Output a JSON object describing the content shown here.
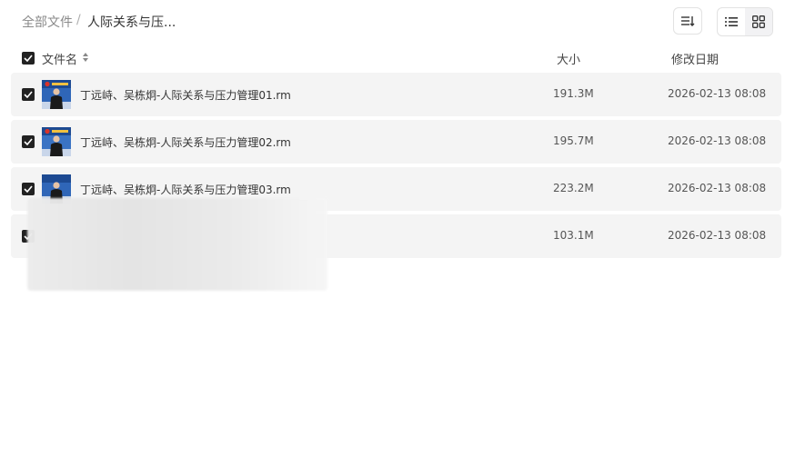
{
  "breadcrumb": {
    "root": "全部文件",
    "separator": "/",
    "current": "人际关系与压..."
  },
  "toolbar": {
    "sort_icon": "sort-icon",
    "list_view_icon": "list-view-icon",
    "grid_view_icon": "grid-view-icon",
    "active_view": "list"
  },
  "table": {
    "headers": {
      "name": "文件名",
      "size": "大小",
      "date": "修改日期"
    },
    "select_all_checked": true,
    "rows": [
      {
        "name": "丁远峙、吴栋炯-人际关系与压力管理01.rm",
        "size": "191.3M",
        "date": "2026-02-13 08:08",
        "checked": true
      },
      {
        "name": "丁远峙、吴栋炯-人际关系与压力管理02.rm",
        "size": "195.7M",
        "date": "2026-02-13 08:08",
        "checked": true
      },
      {
        "name": "丁远峙、吴栋炯-人际关系与压力管理03.rm",
        "size": "223.2M",
        "date": "2026-02-13 08:08",
        "checked": true
      },
      {
        "name": "",
        "size": "103.1M",
        "date": "2026-02-13 08:08",
        "checked": true
      }
    ]
  },
  "colors": {
    "row_bg": "#f4f4f4",
    "checkbox": "#222222",
    "thumb_blue": "#2f66b8"
  }
}
